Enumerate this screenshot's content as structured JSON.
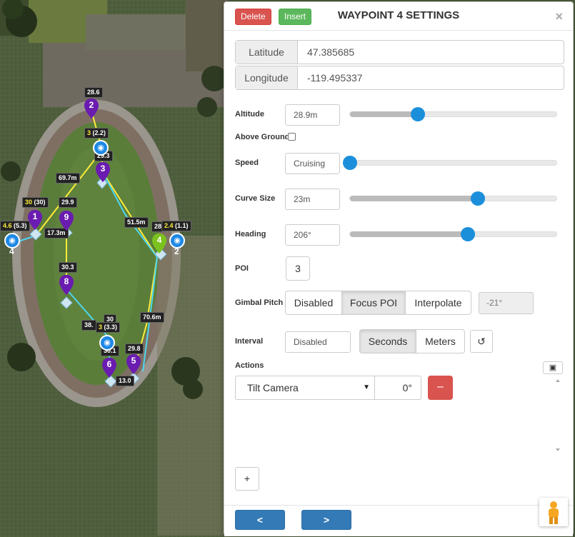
{
  "map": {
    "distance_labels": [
      "28.6",
      "29.3",
      "69.7m",
      "29.9",
      "17.3m",
      "51.5m",
      "28.",
      "30.3",
      "30",
      "38.",
      "29.8",
      "30.1",
      "70.6m",
      "13.0"
    ],
    "altitude_labels": [
      {
        "alt": "3",
        "diff": "(2.2)"
      },
      {
        "alt": "30",
        "diff": "(30)"
      },
      {
        "alt": "4.6",
        "diff": "(5.3)"
      },
      {
        "alt": "2.4",
        "diff": "(1.1)"
      },
      {
        "alt": "3",
        "diff": "(3.3)"
      }
    ],
    "waypoints": [
      "1",
      "2",
      "3",
      "4",
      "5",
      "6",
      "8",
      "9"
    ],
    "camera_numbers": [
      "4",
      "2"
    ],
    "colors": {
      "waypoint": "#6a1bb0",
      "selected_waypoint": "#7cc21e",
      "path_yellow": "#ffeb3b",
      "path_cyan": "#4dd6f0",
      "camera": "#1e88e5"
    }
  },
  "panel": {
    "title": "WAYPOINT 4 SETTINGS",
    "delete_label": "Delete",
    "insert_label": "Insert",
    "close_glyph": "×",
    "latitude": {
      "label": "Latitude",
      "value": "47.385685"
    },
    "longitude": {
      "label": "Longitude",
      "value": "-119.495337"
    },
    "altitude": {
      "label": "Altitude",
      "value": "28.9m",
      "slider_fraction": 0.33
    },
    "above_ground": {
      "label": "Above Ground",
      "checked": false
    },
    "speed": {
      "label": "Speed",
      "value": "Cruising",
      "slider_fraction": 0.0
    },
    "curve_size": {
      "label": "Curve Size",
      "value": "23m",
      "slider_fraction": 0.62
    },
    "heading": {
      "label": "Heading",
      "value": "206°",
      "slider_fraction": 0.57
    },
    "poi": {
      "label": "POI",
      "value": "3"
    },
    "gimbal_pitch": {
      "label": "Gimbal Pitch",
      "options": [
        "Disabled",
        "Focus POI",
        "Interpolate"
      ],
      "selected": "Focus POI",
      "value": "-21°"
    },
    "interval": {
      "label": "Interval",
      "value": "Disabled",
      "options": [
        "Seconds",
        "Meters"
      ],
      "selected": "Seconds"
    },
    "actions": {
      "label": "Actions",
      "items": [
        {
          "type": "Tilt Camera",
          "value": "0°"
        }
      ],
      "remove_glyph": "–",
      "add_glyph": "+"
    },
    "nav": {
      "prev": "<",
      "next": ">"
    }
  }
}
